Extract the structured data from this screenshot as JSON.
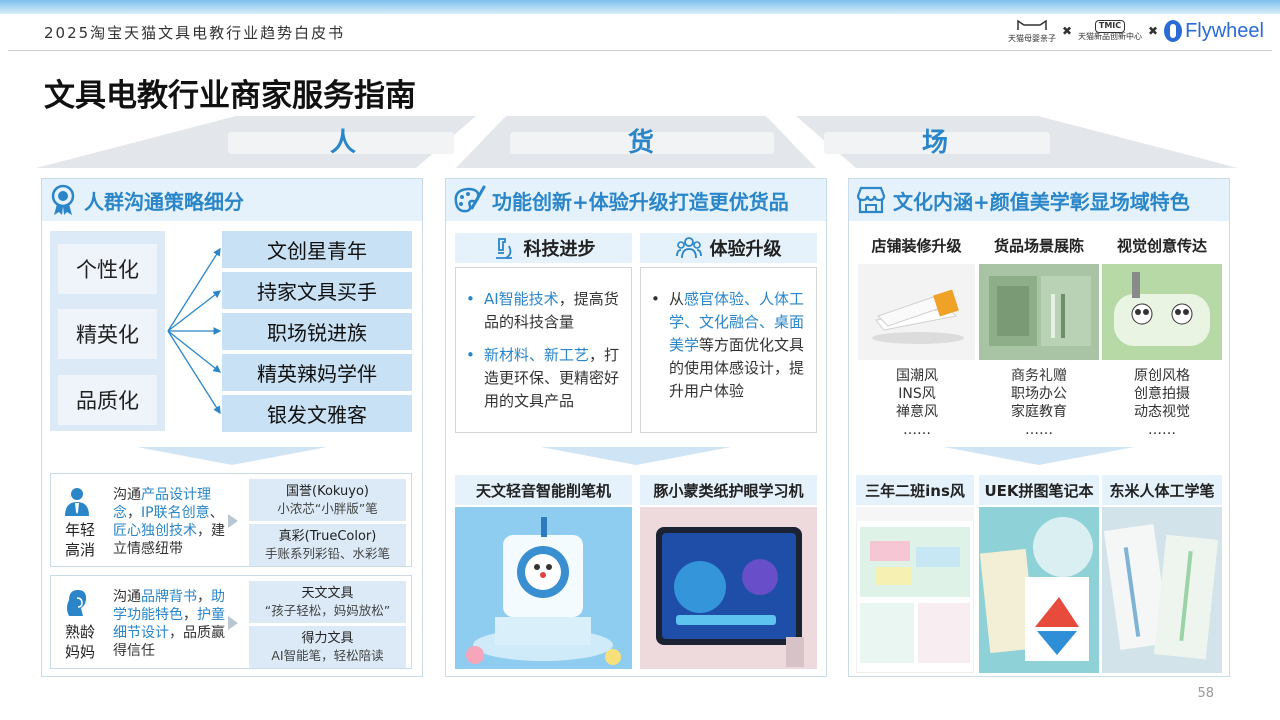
{
  "header": {
    "title": "2025淘宝天猫文具电教行业趋势白皮书",
    "logo1": "天猫母婴亲子",
    "logo2_box": "TMIC",
    "logo2_sub": "天猫新品创新中心",
    "sep": "✖",
    "logo3": "Flywheel"
  },
  "page_title": "文具电教行业商家服务指南",
  "pillars": [
    "人",
    "货",
    "场"
  ],
  "col1": {
    "heading": "人群沟通策略细分",
    "segments": [
      "个性化",
      "精英化",
      "品质化"
    ],
    "personas": [
      "文创星青年",
      "持家文具买手",
      "职场锐进族",
      "精英辣妈学伴",
      "银发文雅客"
    ],
    "card1": {
      "who": "年轻高消",
      "desc_parts": [
        "沟通",
        "产品设计理念",
        "，",
        "IP联名创意",
        "、",
        "匠心独创技术",
        "，建立情感纽带"
      ],
      "brands": [
        {
          "name": "国誉(Kokuyo)",
          "sub": "小浓芯“小胖版”笔"
        },
        {
          "name": "真彩(TrueColor)",
          "sub": "手账系列彩铅、水彩笔"
        }
      ]
    },
    "card2": {
      "who": "熟龄妈妈",
      "desc_parts": [
        "沟通",
        "品牌背书",
        "，",
        "助学功能特色",
        "，",
        "护童细节设计",
        "，品质赢得信任"
      ],
      "brands": [
        {
          "name": "天文文具",
          "sub": "“孩子轻松，妈妈放松”"
        },
        {
          "name": "得力文具",
          "sub": "AI智能笔，轻松陪读"
        }
      ]
    }
  },
  "col2": {
    "heading": "功能创新+体验升级打造更优货品",
    "sub1": "科技进步",
    "sub2": "体验升级",
    "bullets1": [
      {
        "hl": "AI智能技术",
        "rest": "，提高货品的科技含量"
      },
      {
        "hl": "新材料、新工艺",
        "rest": "，打造更环保、更精密好用的文具产品"
      }
    ],
    "bullet2": {
      "pre": "从",
      "hl": "感官体验、人体工学、文化融合、桌面美学",
      "rest": "等方面优化文具的使用体感设计，提升用户体验"
    },
    "bullet_marker": "•",
    "products": [
      "天文轻音智能削笔机",
      "豚小蒙类纸护眼学习机"
    ]
  },
  "col3": {
    "heading": "文化内涵+颜值美学彰显场域特色",
    "categories": [
      "店铺装修升级",
      "货品场景展陈",
      "视觉创意传达"
    ],
    "styles": [
      [
        "国潮风",
        "INS风",
        "禅意风",
        "……"
      ],
      [
        "商务礼赠",
        "职场办公",
        "家庭教育",
        "……"
      ],
      [
        "原创风格",
        "创意拍摄",
        "动态视觉",
        "……"
      ]
    ],
    "products": [
      "三年二班ins风",
      "UEK拼图笔记本",
      "东米人体工学笔"
    ]
  },
  "page_number": "58"
}
